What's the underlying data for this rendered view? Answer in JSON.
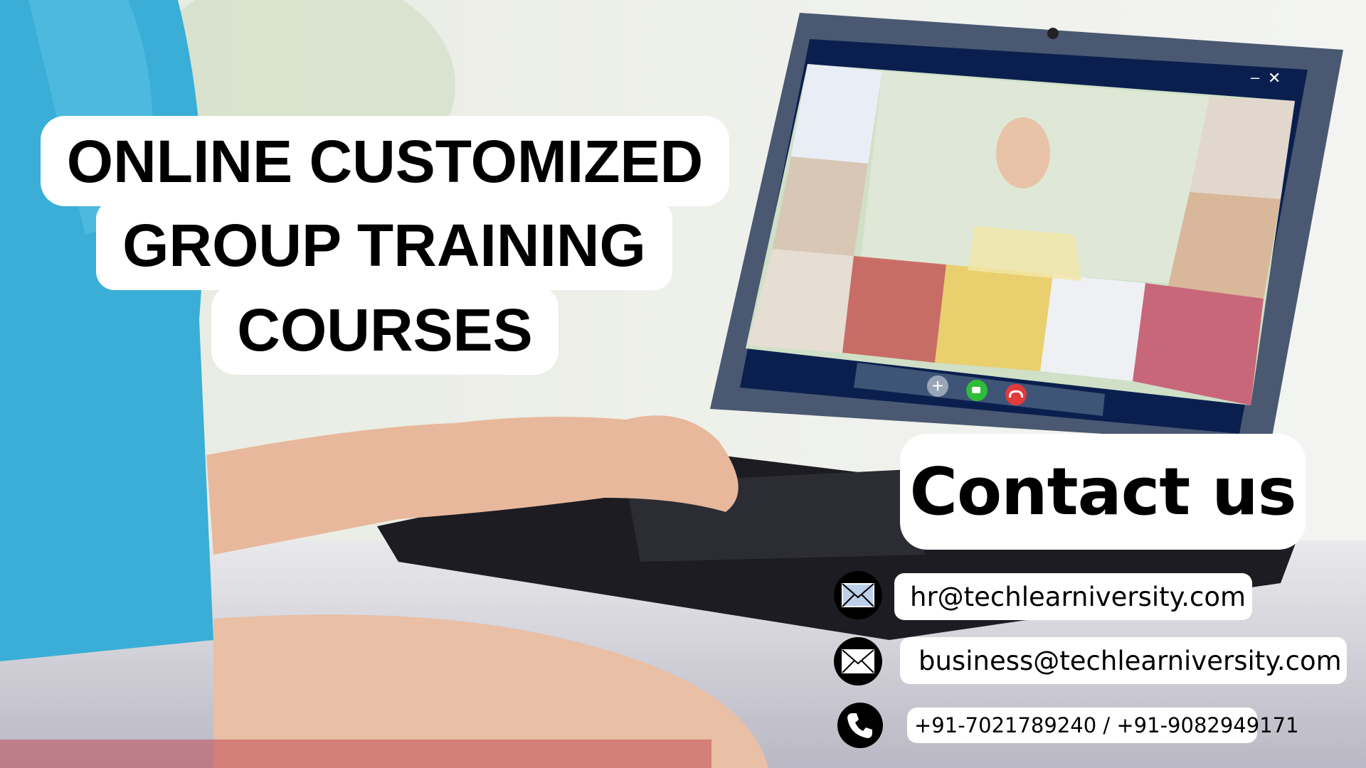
{
  "headline": {
    "line1": "ONLINE CUSTOMIZED",
    "line2": "GROUP TRAINING",
    "line3": "COURSES"
  },
  "contact": {
    "title": "Contact us",
    "items": [
      {
        "icon": "envelope-icon",
        "text": "hr@techlearniversity.com"
      },
      {
        "icon": "envelope-icon",
        "text": "business@techlearniversity.com"
      },
      {
        "icon": "phone-icon",
        "text": "+91-7021789240 / +91-9082949171"
      }
    ]
  },
  "video_call": {
    "window_controls": {
      "minimize": "–",
      "close": "✕"
    },
    "colors": {
      "frame": "#0b1f4f",
      "add": "#9aa4b8",
      "video": "#2ebd3a",
      "hangup": "#e23b3b"
    }
  }
}
